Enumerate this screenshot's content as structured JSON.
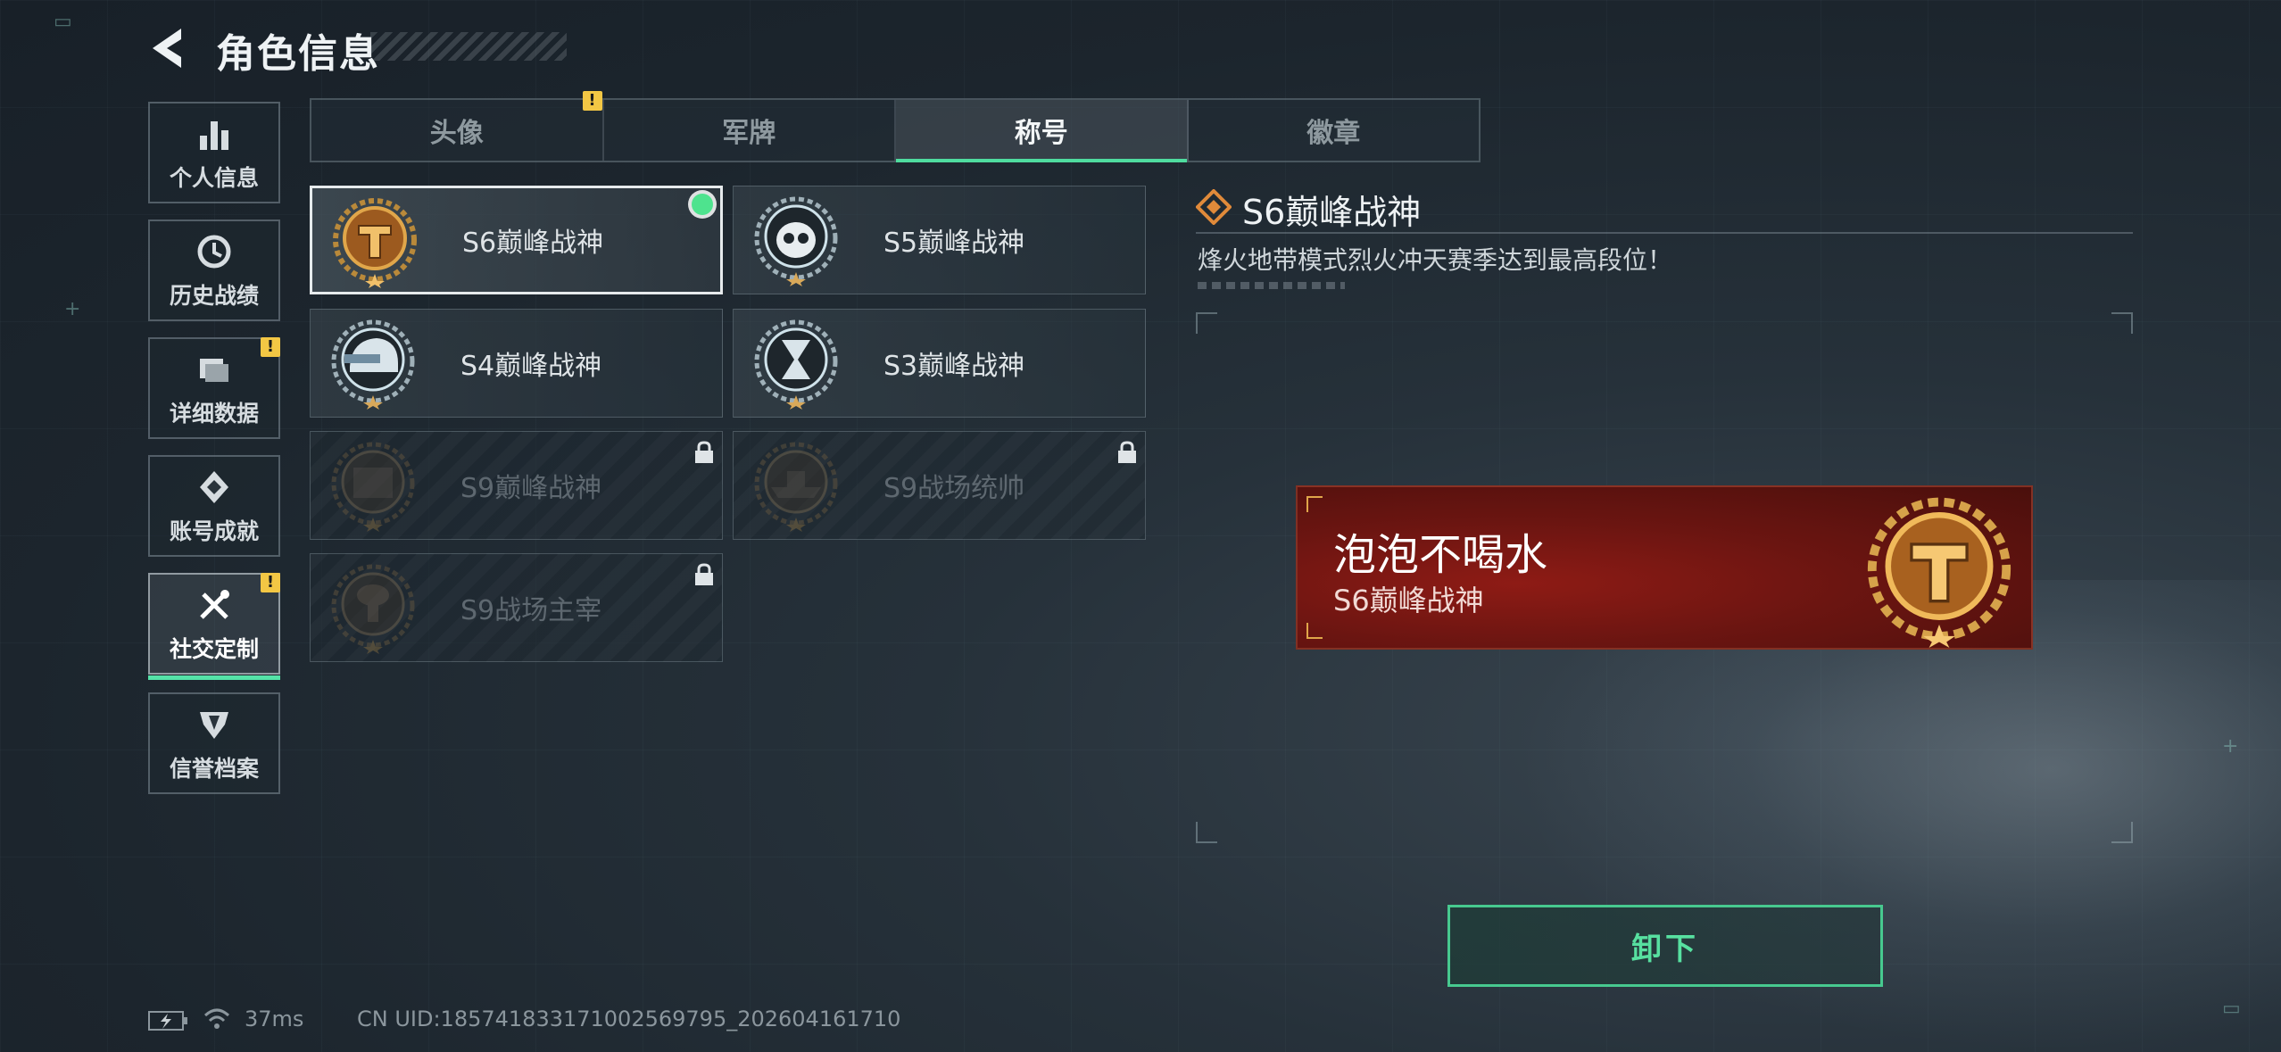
{
  "header": {
    "title": "角色信息"
  },
  "sidebar": {
    "items": [
      {
        "label": "个人信息",
        "icon": "bar-chart-icon",
        "badge": ""
      },
      {
        "label": "历史战绩",
        "icon": "history-clock-icon",
        "badge": ""
      },
      {
        "label": "详细数据",
        "icon": "folder-icon",
        "badge": "!"
      },
      {
        "label": "账号成就",
        "icon": "achievement-medal-icon",
        "badge": ""
      },
      {
        "label": "社交定制",
        "icon": "tools-icon",
        "badge": "!",
        "active": true
      },
      {
        "label": "信誉档案",
        "icon": "shield-emblem-icon",
        "badge": ""
      }
    ]
  },
  "tabs": [
    {
      "label": "头像",
      "badge": "!"
    },
    {
      "label": "军牌",
      "badge": ""
    },
    {
      "label": "称号",
      "badge": "",
      "active": true
    },
    {
      "label": "徽章",
      "badge": ""
    }
  ],
  "titles": [
    {
      "name": "S6巅峰战神",
      "emblem": "gold-t-emblem-icon",
      "selected": true,
      "equipped": true,
      "locked": false
    },
    {
      "name": "S5巅峰战神",
      "emblem": "skull-emblem-icon",
      "selected": false,
      "equipped": false,
      "locked": false
    },
    {
      "name": "S4巅峰战神",
      "emblem": "helmet-emblem-icon",
      "selected": false,
      "equipped": false,
      "locked": false
    },
    {
      "name": "S3巅峰战神",
      "emblem": "hourglass-emblem-icon",
      "selected": false,
      "equipped": false,
      "locked": false
    },
    {
      "name": "S9巅峰战神",
      "emblem": "fortress-emblem-icon",
      "selected": false,
      "equipped": false,
      "locked": true
    },
    {
      "name": "S9战场统帅",
      "emblem": "warship-emblem-icon",
      "selected": false,
      "equipped": false,
      "locked": true
    },
    {
      "name": "S9战场主宰",
      "emblem": "mushroom-cloud-emblem-icon",
      "selected": false,
      "equipped": false,
      "locked": true
    }
  ],
  "detail": {
    "title": "S6巅峰战神",
    "description": "烽火地带模式烈火冲天赛季达到最高段位！"
  },
  "nameplate": {
    "player_name": "泡泡不喝水",
    "title": "S6巅峰战神"
  },
  "actions": {
    "unequip_label": "卸下"
  },
  "status_bar": {
    "ping": "37ms",
    "uid": "CN UID:185741833171002569795_202604161710"
  },
  "colors": {
    "accent": "#4fdc9f",
    "badge": "#f3c744",
    "plate": "#7a1612",
    "gold": "#c8862e"
  }
}
